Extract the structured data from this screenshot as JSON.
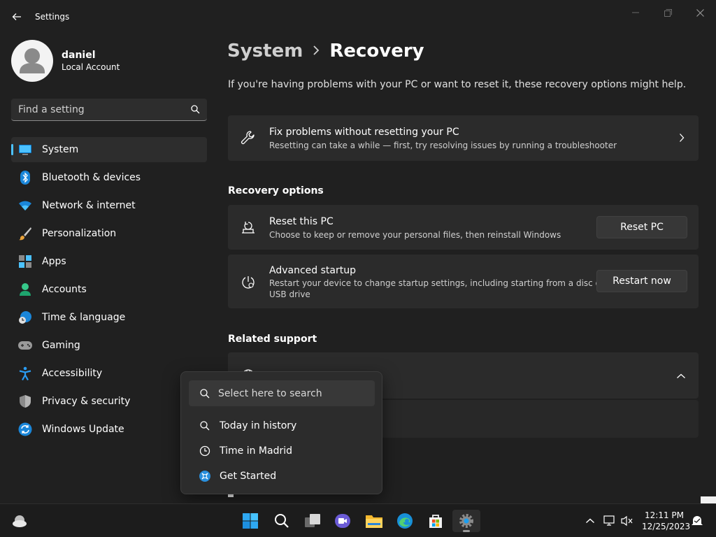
{
  "app": {
    "title": "Settings"
  },
  "profile": {
    "name": "daniel",
    "account_type": "Local Account"
  },
  "search": {
    "placeholder": "Find a setting"
  },
  "nav": {
    "items": [
      {
        "label": "System",
        "active": true
      },
      {
        "label": "Bluetooth & devices"
      },
      {
        "label": "Network & internet"
      },
      {
        "label": "Personalization"
      },
      {
        "label": "Apps"
      },
      {
        "label": "Accounts"
      },
      {
        "label": "Time & language"
      },
      {
        "label": "Gaming"
      },
      {
        "label": "Accessibility"
      },
      {
        "label": "Privacy & security"
      },
      {
        "label": "Windows Update"
      }
    ]
  },
  "breadcrumb": {
    "parent": "System",
    "current": "Recovery"
  },
  "intro": "If you're having problems with your PC or want to reset it, these recovery options might help.",
  "fix_card": {
    "title": "Fix problems without resetting your PC",
    "description": "Resetting can take a while — first, try resolving issues by running a troubleshooter"
  },
  "recovery_options": {
    "heading": "Recovery options",
    "reset": {
      "title": "Reset this PC",
      "description": "Choose to keep or remove your personal files, then reinstall Windows",
      "button": "Reset PC"
    },
    "advanced": {
      "title": "Advanced startup",
      "description_line1": "Restart your device to change startup settings, including starting from a disc or",
      "description_line2": "USB drive",
      "button": "Restart now"
    }
  },
  "related_support": {
    "heading": "Related support"
  },
  "popup": {
    "search_placeholder": "Select here to search",
    "items": [
      {
        "label": "Today in history"
      },
      {
        "label": "Time in Madrid"
      },
      {
        "label": "Get Started"
      }
    ]
  },
  "clock": {
    "time": "12:11 PM",
    "date": "12/25/2023"
  },
  "colors": {
    "accent": "#4cc2ff",
    "background": "#202020",
    "card": "#2b2b2b"
  }
}
